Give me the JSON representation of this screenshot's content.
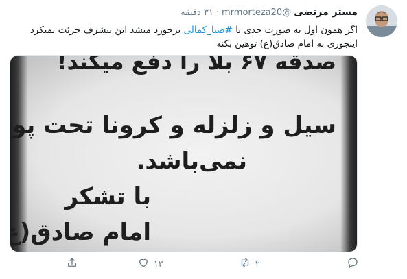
{
  "tweet": {
    "display_name": "مستر مرتضی",
    "handle": "@mrmorteza20",
    "separator": "·",
    "time": "۳۱ دقیقه",
    "text_part1": "اگر همون اول به صورت جدی با ",
    "hashtag": "#صبا_کمالی",
    "text_part2": " برخورد میشد این بیشرف جرئت نمیکرد اینجوری به امام صادق(ع) توهین بکنه"
  },
  "media": {
    "line1": "صدقه ۶۷ بلا را دفع میکند!",
    "line2": "سیل و زلزله و کرونا تحت پوشش",
    "line3": "نمی‌باشد.",
    "line4": "با تشکر",
    "line5": "امام صادق(ع)"
  },
  "actions": {
    "reply_count": "",
    "retweet_count": "۲",
    "like_count": "۱۲",
    "share_count": ""
  },
  "icons": {
    "reply": "reply-icon",
    "retweet": "retweet-icon",
    "like": "heart-icon",
    "share": "share-icon"
  },
  "colors": {
    "hashtag": "#1b95e0",
    "secondary_text": "#657786"
  }
}
